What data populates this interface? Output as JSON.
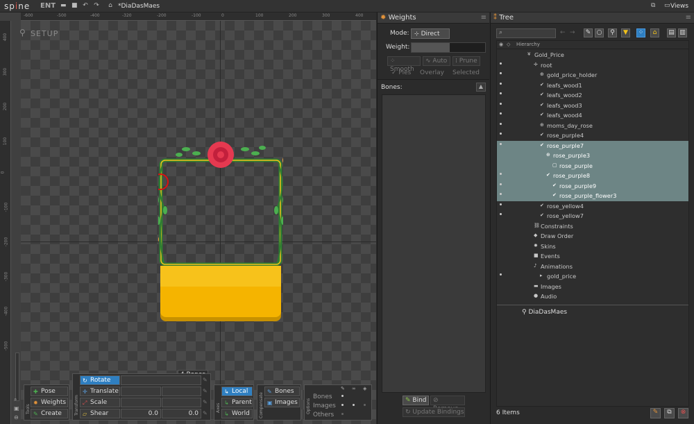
{
  "topbar": {
    "logo_a": "sp",
    "logo_b": "i",
    "logo_c": "ne",
    "edition": "ENT",
    "document": "*DiaDasMaes",
    "views": "Views"
  },
  "viewport": {
    "mode": "SETUP",
    "bones_tip": "4 Bones",
    "ruler_top": [
      "-600",
      "-500",
      "-400",
      "-320",
      "-300",
      "-200",
      "-100",
      "0",
      "100",
      "200",
      "300",
      "400",
      "500",
      "600"
    ],
    "ruler_left": [
      "400",
      "300",
      "200",
      "100",
      "0",
      "-100",
      "-200",
      "-300",
      "-400",
      "-500"
    ]
  },
  "toolbar": {
    "tools": {
      "label": "Tools",
      "pose": "Pose",
      "weights": "Weights",
      "create": "Create"
    },
    "transform": {
      "label": "Transform",
      "rotate": "Rotate",
      "translate": "Translate",
      "scale": "Scale",
      "shear": "Shear",
      "shear_x": "0.0",
      "shear_y": "0.0"
    },
    "axes": {
      "label": "Axes",
      "local": "Local",
      "parent": "Parent",
      "world": "World"
    },
    "compensate": {
      "label": "Compensate",
      "bones": "Bones",
      "images": "Images"
    },
    "options": {
      "label": "Options",
      "bones": "Bones",
      "images": "Images",
      "others": "Others"
    }
  },
  "weights": {
    "title": "Weights",
    "mode_label": "Mode:",
    "mode_value": "Direct",
    "weight_label": "Weight:",
    "smooth": "Smooth",
    "auto": "Auto",
    "prune": "Prune",
    "pies": "Pies",
    "overlay": "Overlay",
    "selected": "Selected",
    "bones_label": "Bones:",
    "bind": "Bind",
    "remove": "Remove",
    "update": "Update Bindings"
  },
  "tree": {
    "title": "Tree",
    "hierarchy": "Hierarchy",
    "footer": "6 Items",
    "project": "DiaDasMaes",
    "rows": [
      {
        "label": "Gold_Price",
        "indent": 0,
        "icon": "¥",
        "eye": false,
        "sel": false
      },
      {
        "label": "root",
        "indent": 1,
        "icon": "✛",
        "eye": true,
        "sel": false
      },
      {
        "label": "gold_price_holder",
        "indent": 2,
        "icon": "⊕",
        "eye": true,
        "sel": false
      },
      {
        "label": "leafs_wood1",
        "indent": 2,
        "icon": "✔",
        "eye": true,
        "sel": false
      },
      {
        "label": "leafs_wood2",
        "indent": 2,
        "icon": "✔",
        "eye": true,
        "sel": false
      },
      {
        "label": "leafs_wood3",
        "indent": 2,
        "icon": "✔",
        "eye": true,
        "sel": false
      },
      {
        "label": "leafs_wood4",
        "indent": 2,
        "icon": "✔",
        "eye": true,
        "sel": false
      },
      {
        "label": "moms_day_rose",
        "indent": 2,
        "icon": "⊕",
        "eye": true,
        "sel": false
      },
      {
        "label": "rose_purple4",
        "indent": 2,
        "icon": "✔",
        "eye": true,
        "sel": false
      },
      {
        "label": "rose_purple7",
        "indent": 2,
        "icon": "✔",
        "eye": true,
        "sel": true
      },
      {
        "label": "rose_purple3",
        "indent": 3,
        "icon": "⊕",
        "eye": false,
        "sel": true
      },
      {
        "label": "rose_purple",
        "indent": 4,
        "icon": "▢",
        "eye": false,
        "sel": true
      },
      {
        "label": "rose_purple8",
        "indent": 3,
        "icon": "✔",
        "eye": true,
        "sel": true
      },
      {
        "label": "rose_purple9",
        "indent": 4,
        "icon": "✔",
        "eye": true,
        "sel": true
      },
      {
        "label": "rose_purple_flower3",
        "indent": 4,
        "icon": "✔",
        "eye": true,
        "sel": true
      },
      {
        "label": "rose_yellow4",
        "indent": 2,
        "icon": "✔",
        "eye": true,
        "sel": false
      },
      {
        "label": "rose_yellow7",
        "indent": 2,
        "icon": "✔",
        "eye": true,
        "sel": false
      },
      {
        "label": "Constraints",
        "indent": 1,
        "icon": "⛓",
        "eye": false,
        "sel": false
      },
      {
        "label": "Draw Order",
        "indent": 1,
        "icon": "◆",
        "eye": false,
        "sel": false
      },
      {
        "label": "Skins",
        "indent": 1,
        "icon": "✹",
        "eye": false,
        "sel": false
      },
      {
        "label": "Events",
        "indent": 1,
        "icon": "■",
        "eye": false,
        "sel": false
      },
      {
        "label": "Animations",
        "indent": 1,
        "icon": "♪",
        "eye": false,
        "sel": false
      },
      {
        "label": "gold_price",
        "indent": 2,
        "icon": "▸",
        "eye": true,
        "sel": false
      },
      {
        "label": "Images",
        "indent": 1,
        "icon": "▬",
        "eye": false,
        "sel": false
      },
      {
        "label": "Audio",
        "indent": 1,
        "icon": "●",
        "eye": false,
        "sel": false
      }
    ]
  }
}
